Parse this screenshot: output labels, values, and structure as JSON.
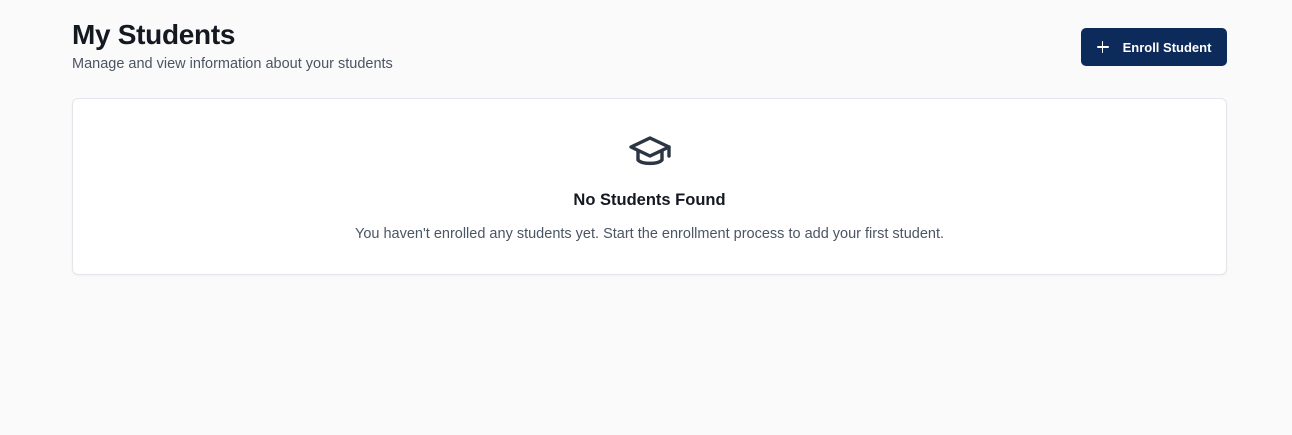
{
  "header": {
    "title": "My Students",
    "subtitle": "Manage and view information about your students",
    "enroll_button_label": "Enroll Student",
    "enroll_button_icon": "plus-icon"
  },
  "empty_state": {
    "icon": "graduation-cap-icon",
    "title": "No Students Found",
    "description": "You haven't enrolled any students yet. Start the enrollment process to add your first student."
  },
  "colors": {
    "background": "#fafafa",
    "primary_button": "#0c2a5a",
    "icon": "#2b3544"
  }
}
